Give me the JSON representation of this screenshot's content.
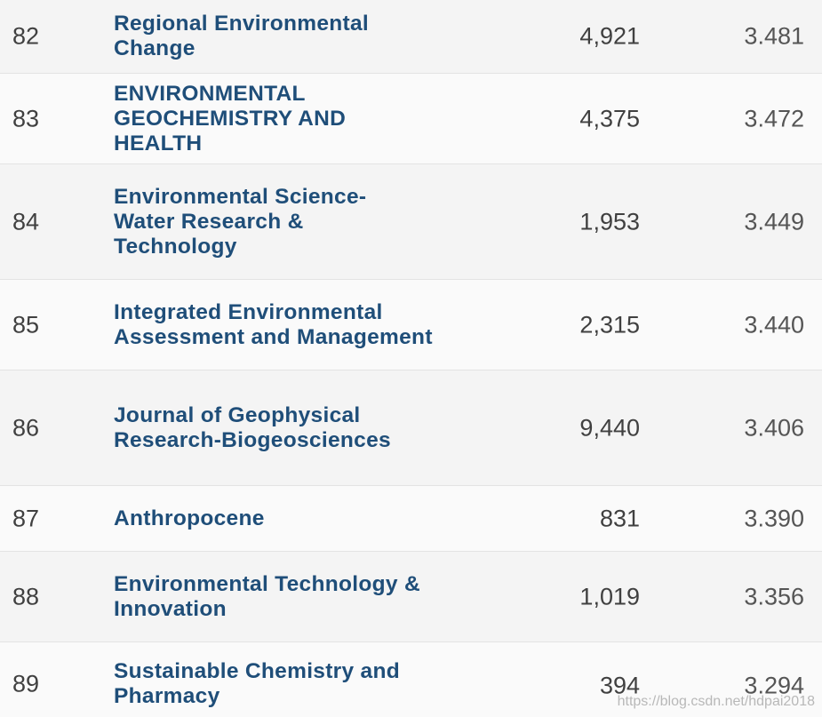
{
  "rows": [
    {
      "rank": "82",
      "title": "Regional Environmental Change",
      "cites": "4,921",
      "impact": "3.481"
    },
    {
      "rank": "83",
      "title": "ENVIRONMENTAL GEOCHEMISTRY AND HEALTH",
      "cites": "4,375",
      "impact": "3.472"
    },
    {
      "rank": "84",
      "title": "Environmental Science-Water Research & Technology",
      "cites": "1,953",
      "impact": "3.449"
    },
    {
      "rank": "85",
      "title": "Integrated Environmental Assessment and Management",
      "cites": "2,315",
      "impact": "3.440"
    },
    {
      "rank": "86",
      "title": "Journal of Geophysical Research-Biogeosciences",
      "cites": "9,440",
      "impact": "3.406"
    },
    {
      "rank": "87",
      "title": "Anthropocene",
      "cites": "831",
      "impact": "3.390"
    },
    {
      "rank": "88",
      "title": "Environmental Technology & Innovation",
      "cites": "1,019",
      "impact": "3.356"
    },
    {
      "rank": "89",
      "title": "Sustainable Chemistry and Pharmacy",
      "cites": "394",
      "impact": "3.294"
    }
  ],
  "watermark": "https://blog.csdn.net/hdpai2018"
}
